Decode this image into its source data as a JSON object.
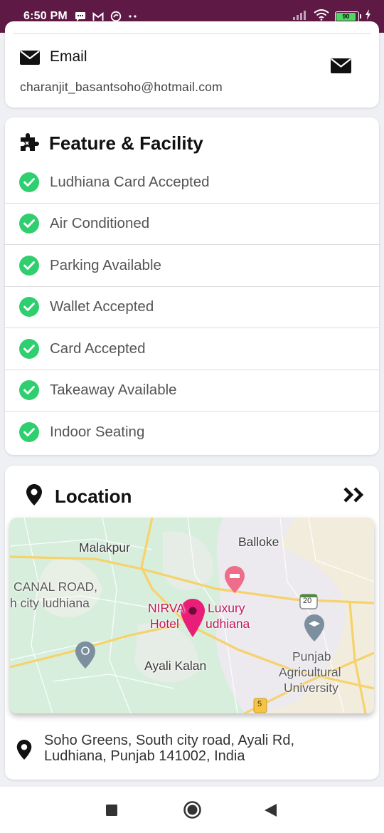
{
  "status_bar": {
    "time": "6:50 PM",
    "notification_icons": [
      "message-icon",
      "gmail-icon",
      "sync-icon",
      "more-dots-icon"
    ],
    "battery_level": "90",
    "colors": {
      "background": "#5e1a45",
      "battery": "#4cd964"
    }
  },
  "email_card": {
    "label": "Email",
    "value": "charanjit_basantsoho@hotmail.com"
  },
  "features": {
    "title": "Feature & Facility",
    "items": [
      {
        "label": "Ludhiana Card Accepted"
      },
      {
        "label": "Air Conditioned"
      },
      {
        "label": "Parking Available"
      },
      {
        "label": "Wallet Accepted"
      },
      {
        "label": "Card Accepted"
      },
      {
        "label": "Takeaway Available"
      },
      {
        "label": "Indoor Seating"
      }
    ],
    "check_color": "#2fce6f"
  },
  "location": {
    "title": "Location",
    "map_labels": {
      "malakpur": "Malakpur",
      "balloke": "Balloke",
      "canal_road": "CANAL ROAD,",
      "south_city": "h city ludhiana",
      "nirvana": "NIRVA",
      "luxury": "Luxury",
      "hotel": "Hotel",
      "ludhiana": "udhiana",
      "ayali_kalan": "Ayali Kalan",
      "punjab": "Punjab",
      "agricultural": "Agricultural",
      "university": "University",
      "route_20": "20",
      "route_5": "5"
    },
    "address": "Soho Greens, South city road, Ayali Rd, Ludhiana, Punjab 141002, India",
    "pin_color": "#e91e78"
  },
  "nav_bar": {
    "buttons": [
      "recents-button",
      "home-button",
      "back-button"
    ]
  }
}
